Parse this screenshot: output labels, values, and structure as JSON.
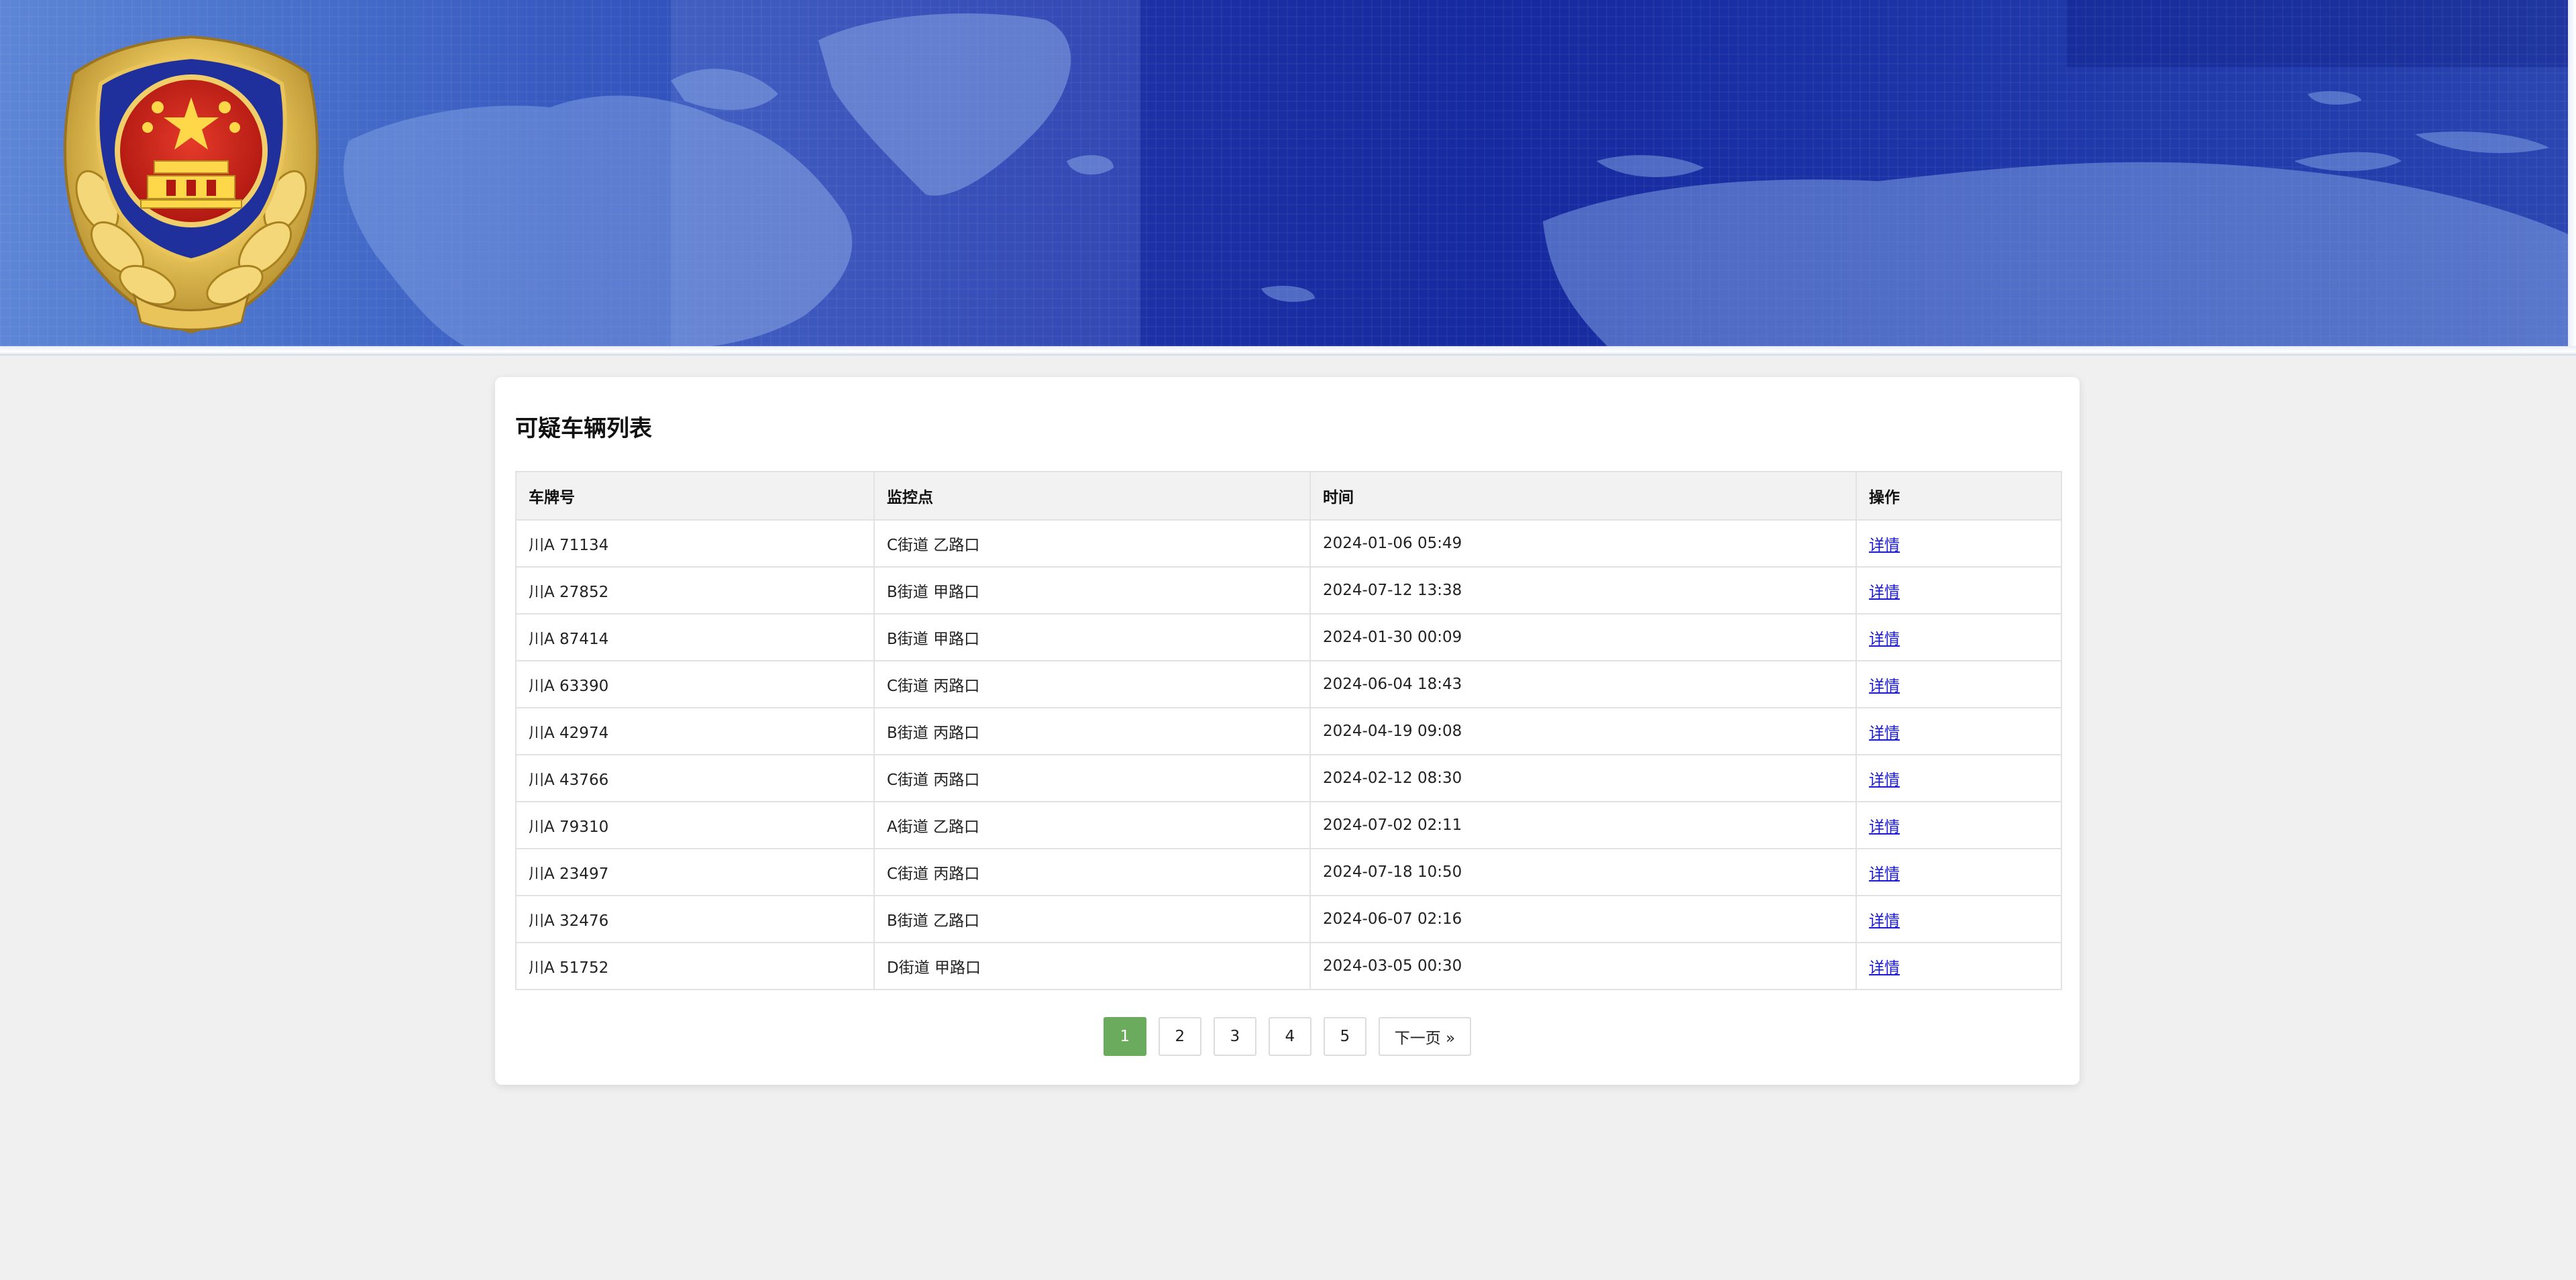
{
  "header": {
    "emblem_icon": "police-emblem-icon",
    "background": "world-map-banner"
  },
  "colors": {
    "accent": "#6aab5e",
    "link": "#1a1ad8",
    "banner_blue": "#1f36ac"
  },
  "main": {
    "title": "可疑车辆列表",
    "table": {
      "columns": [
        "车牌号",
        "监控点",
        "时间",
        "操作"
      ],
      "rows": [
        {
          "plate": "川A 71134",
          "location": "C街道 乙路口",
          "time": "2024-01-06 05:49",
          "action": "详情"
        },
        {
          "plate": "川A 27852",
          "location": "B街道 甲路口",
          "time": "2024-07-12 13:38",
          "action": "详情"
        },
        {
          "plate": "川A 87414",
          "location": "B街道 甲路口",
          "time": "2024-01-30 00:09",
          "action": "详情"
        },
        {
          "plate": "川A 63390",
          "location": "C街道 丙路口",
          "time": "2024-06-04 18:43",
          "action": "详情"
        },
        {
          "plate": "川A 42974",
          "location": "B街道 丙路口",
          "time": "2024-04-19 09:08",
          "action": "详情"
        },
        {
          "plate": "川A 43766",
          "location": "C街道 丙路口",
          "time": "2024-02-12 08:30",
          "action": "详情"
        },
        {
          "plate": "川A 79310",
          "location": "A街道 乙路口",
          "time": "2024-07-02 02:11",
          "action": "详情"
        },
        {
          "plate": "川A 23497",
          "location": "C街道 丙路口",
          "time": "2024-07-18 10:50",
          "action": "详情"
        },
        {
          "plate": "川A 32476",
          "location": "B街道 乙路口",
          "time": "2024-06-07 02:16",
          "action": "详情"
        },
        {
          "plate": "川A 51752",
          "location": "D街道 甲路口",
          "time": "2024-03-05 00:30",
          "action": "详情"
        }
      ]
    },
    "pagination": {
      "current": 1,
      "pages": [
        "1",
        "2",
        "3",
        "4",
        "5"
      ],
      "next_label": "下一页 »"
    }
  }
}
